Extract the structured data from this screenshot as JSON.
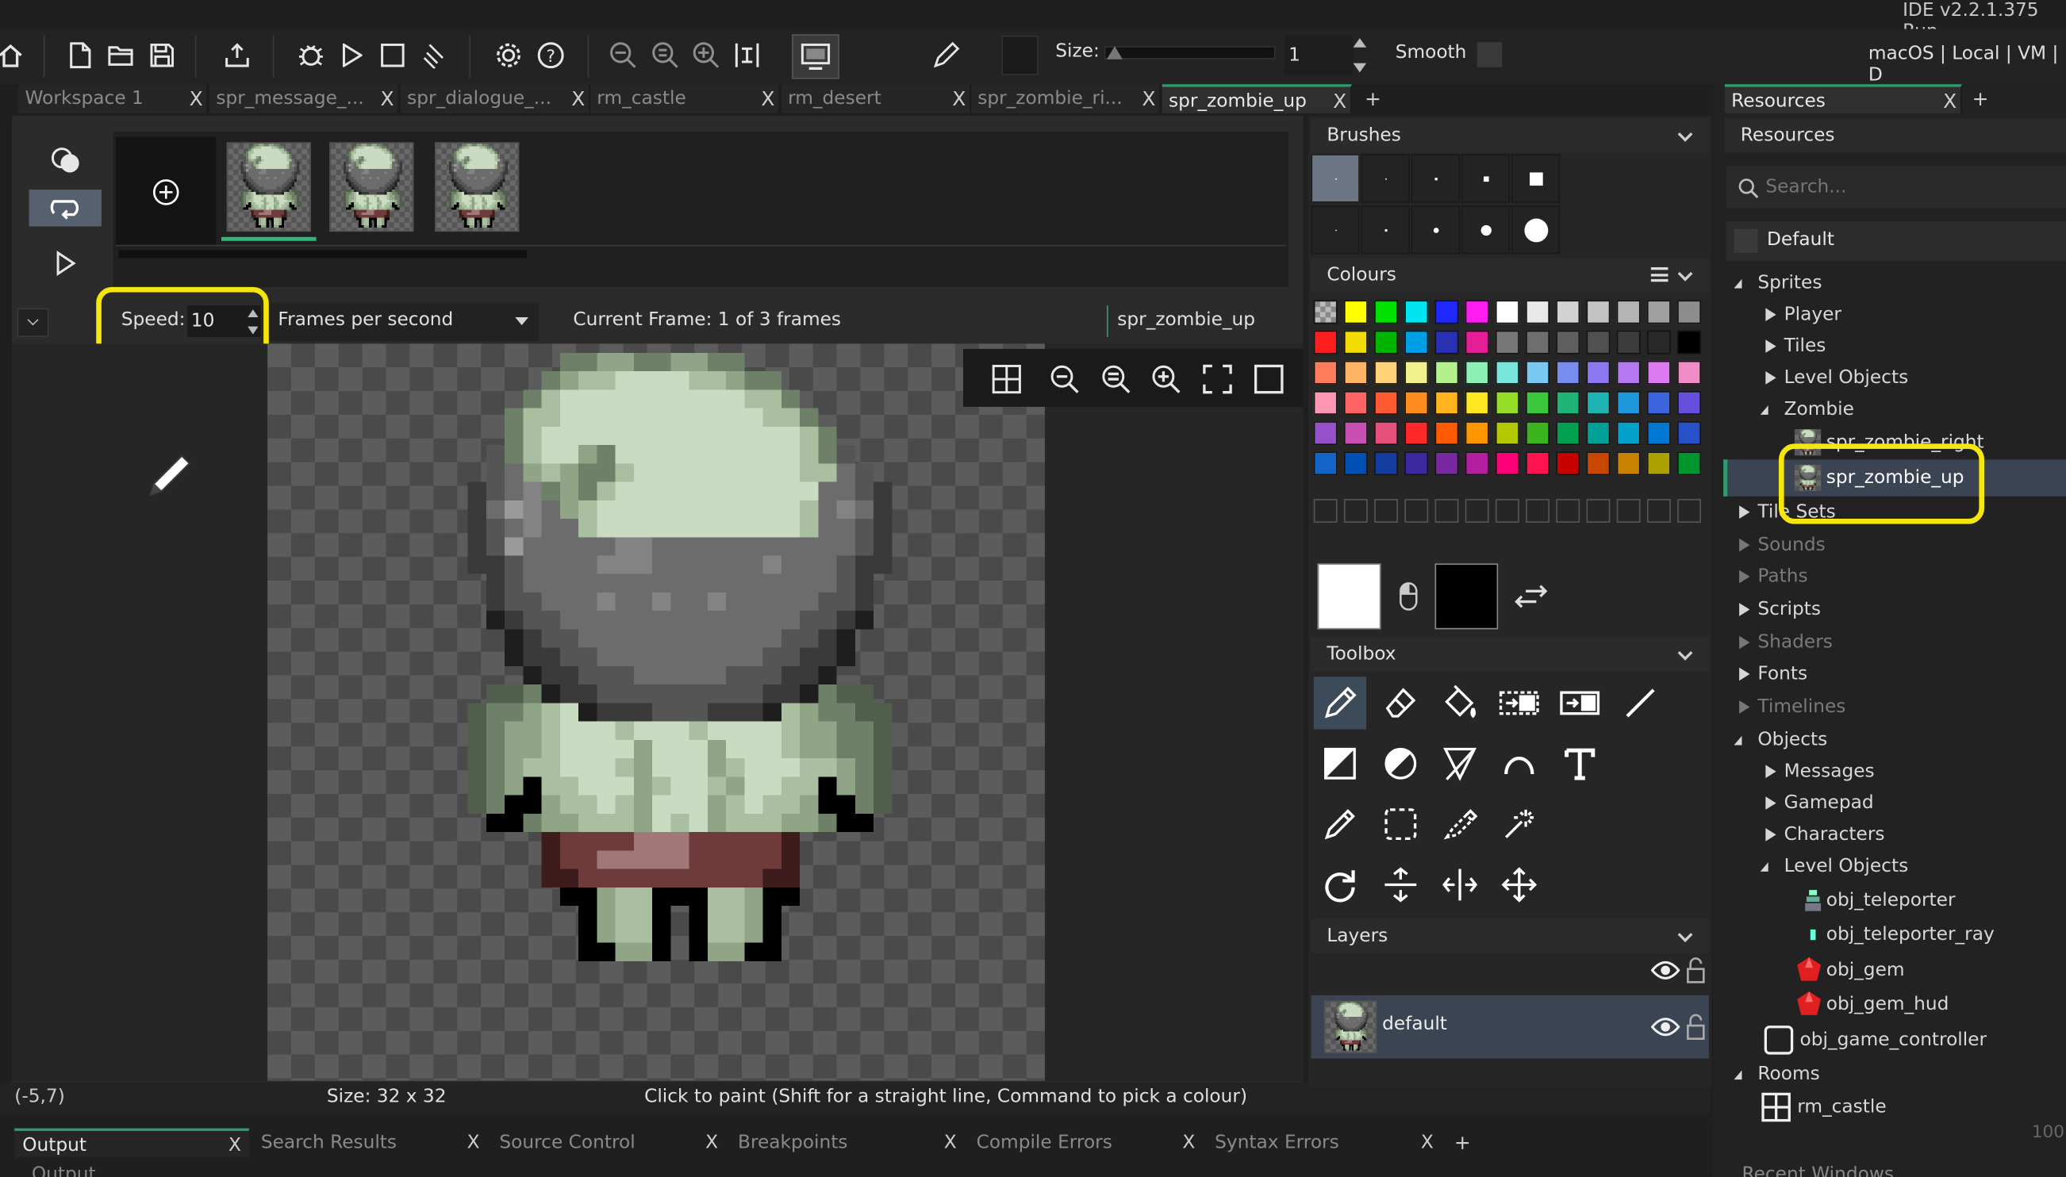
{
  "app": {
    "version": "IDE v2.2.1.375",
    "version_suffix": "Run",
    "target": "macOS | Local | VM | D"
  },
  "toolbar": {
    "size_label": "Size:",
    "size_value": "1",
    "smooth_label": "Smooth"
  },
  "tabs": [
    {
      "label": "Workspace 1",
      "active": false
    },
    {
      "label": "spr_message_...",
      "active": false
    },
    {
      "label": "spr_dialogue_...",
      "active": false
    },
    {
      "label": "rm_castle",
      "active": false
    },
    {
      "label": "rm_desert",
      "active": false
    },
    {
      "label": "spr_zombie_ri...",
      "active": false
    },
    {
      "label": "spr_zombie_up",
      "active": true
    }
  ],
  "tab_close": "X",
  "tab_add": "+",
  "resources_tab": {
    "label": "Resources",
    "close": "X",
    "add": "+"
  },
  "sprite_editor": {
    "speed_label": "Speed:",
    "speed_value": "10",
    "speed_unit": "Frames per second",
    "current_frame": "Current Frame: 1 of 3 frames",
    "sprite_name": "spr_zombie_up",
    "frames": 3,
    "status_coords": "(-5,7)",
    "status_size": "Size: 32 x 32",
    "status_hint": "Click to paint (Shift for a straight line, Command to pick a colour)"
  },
  "brushes": {
    "title": "Brushes"
  },
  "colours": {
    "title": "Colours",
    "rows": [
      [
        "checker",
        "#ffff00",
        "#00e100",
        "#00e5f0",
        "#1e28ff",
        "#ff1ef0",
        "#ffffff",
        "#e8e8e8",
        "#d2d2d2",
        "#c3c3c3",
        "#b4b4b4",
        "#a0a0a0",
        "#8c8c8c"
      ],
      [
        "#ff1e1e",
        "#f0dc00",
        "#00b400",
        "#00a0e6",
        "#2830b4",
        "#e61e96",
        "#787878",
        "#6e6e6e",
        "#5f5f5f",
        "#505050",
        "#3c3c3c",
        "#282828",
        "#000000"
      ],
      [
        "#ff7d5a",
        "#ffb464",
        "#ffd278",
        "#f0f08c",
        "#b4f08c",
        "#8cf0b4",
        "#78e6dc",
        "#78c8f0",
        "#788cf0",
        "#8c78f0",
        "#b478f0",
        "#dc78f0",
        "#f08cc8"
      ],
      [
        "#ff96b4",
        "#ff6464",
        "#ff5a32",
        "#ff8c1e",
        "#ffb41e",
        "#ffe61e",
        "#96dc28",
        "#3cc83c",
        "#1eb478",
        "#1eb4b4",
        "#1e96dc",
        "#3c64dc",
        "#6450dc"
      ],
      [
        "#9650c8",
        "#c850b4",
        "#e6507d",
        "#ff2828",
        "#ff5a00",
        "#ff9600",
        "#b4c800",
        "#3cb41e",
        "#00a050",
        "#00a096",
        "#00a0c8",
        "#0078d2",
        "#2850c8"
      ],
      [
        "#1464c8",
        "#0050b4",
        "#143ca0",
        "#3c28a0",
        "#7828a0",
        "#b41ea0",
        "#ff0078",
        "#ff1450",
        "#c80000",
        "#c84600",
        "#c88200",
        "#aaa000",
        "#00962d"
      ]
    ]
  },
  "toolbox": {
    "title": "Toolbox"
  },
  "layers": {
    "title": "Layers",
    "items": [
      {
        "name": "default"
      }
    ]
  },
  "resources": {
    "title": "Resources",
    "search_placeholder": "Search...",
    "group": "Default",
    "tree": [
      {
        "label": "Sprites",
        "level": 0,
        "state": "open",
        "icon": "none"
      },
      {
        "label": "Player",
        "level": 1,
        "state": "closed",
        "icon": "none"
      },
      {
        "label": "Tiles",
        "level": 1,
        "state": "closed",
        "icon": "none"
      },
      {
        "label": "Level Objects",
        "level": 1,
        "state": "closed",
        "icon": "none"
      },
      {
        "label": "Zombie",
        "level": 1,
        "state": "open",
        "icon": "none"
      },
      {
        "label": "spr_zombie_right",
        "level": 2,
        "state": "leaf",
        "icon": "zombie"
      },
      {
        "label": "spr_zombie_up",
        "level": 2,
        "state": "leaf",
        "icon": "zombie",
        "selected": true
      },
      {
        "label": "Tile Sets",
        "level": 0,
        "state": "closed",
        "icon": "none"
      },
      {
        "label": "Sounds",
        "level": 0,
        "state": "closed-dim",
        "icon": "none"
      },
      {
        "label": "Paths",
        "level": 0,
        "state": "closed-dim",
        "icon": "none"
      },
      {
        "label": "Scripts",
        "level": 0,
        "state": "closed",
        "icon": "none"
      },
      {
        "label": "Shaders",
        "level": 0,
        "state": "closed-dim",
        "icon": "none"
      },
      {
        "label": "Fonts",
        "level": 0,
        "state": "closed",
        "icon": "none"
      },
      {
        "label": "Timelines",
        "level": 0,
        "state": "closed-dim",
        "icon": "none"
      },
      {
        "label": "Objects",
        "level": 0,
        "state": "open",
        "icon": "none"
      },
      {
        "label": "Messages",
        "level": 1,
        "state": "closed",
        "icon": "none"
      },
      {
        "label": "Gamepad",
        "level": 1,
        "state": "closed",
        "icon": "none"
      },
      {
        "label": "Characters",
        "level": 1,
        "state": "closed",
        "icon": "none"
      },
      {
        "label": "Level Objects",
        "level": 1,
        "state": "open",
        "icon": "none"
      },
      {
        "label": "obj_teleporter",
        "level": 2,
        "state": "leaf",
        "icon": "teleporter"
      },
      {
        "label": "obj_teleporter_ray",
        "level": 2,
        "state": "leaf",
        "icon": "ray"
      },
      {
        "label": "obj_gem",
        "level": 2,
        "state": "leaf",
        "icon": "gem"
      },
      {
        "label": "obj_gem_hud",
        "level": 2,
        "state": "leaf",
        "icon": "gem"
      },
      {
        "label": "obj_game_controller",
        "level": 1,
        "state": "leaf",
        "icon": "object"
      },
      {
        "label": "Rooms",
        "level": 0,
        "state": "open",
        "icon": "none"
      },
      {
        "label": "rm_castle",
        "level": 1,
        "state": "leaf",
        "icon": "room"
      }
    ],
    "zoom": "100"
  },
  "bottom_tabs": [
    {
      "label": "Output",
      "active": true
    },
    {
      "label": "Search Results",
      "active": false
    },
    {
      "label": "Source Control",
      "active": false
    },
    {
      "label": "Breakpoints",
      "active": false
    },
    {
      "label": "Compile Errors",
      "active": false
    },
    {
      "label": "Syntax Errors",
      "active": false
    }
  ],
  "bottom_output_partial": "Output",
  "recent_windows_partial": "Recent Windows"
}
